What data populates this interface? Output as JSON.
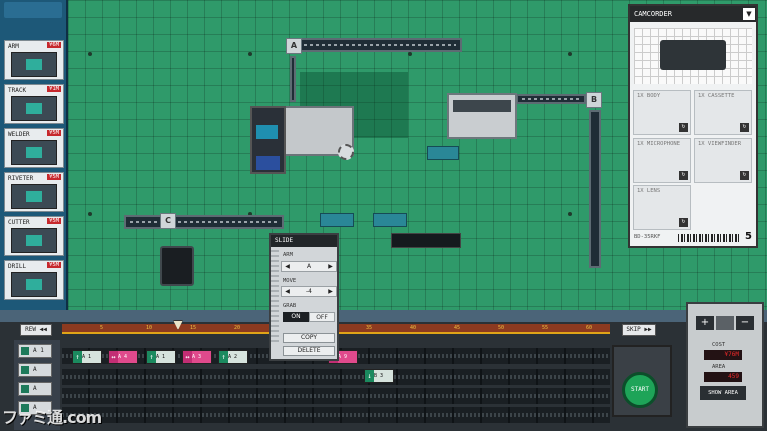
{
  "sidebar": {
    "parts": [
      {
        "name": "ARM",
        "cost": "¥6M"
      },
      {
        "name": "TRACK",
        "cost": "¥1M"
      },
      {
        "name": "WELDER",
        "cost": "¥5M"
      },
      {
        "name": "RIVETER",
        "cost": "¥5M"
      },
      {
        "name": "CUTTER",
        "cost": "¥5M"
      },
      {
        "name": "DRILL",
        "cost": "¥5M"
      }
    ]
  },
  "floor": {
    "nodes": {
      "a": "A",
      "b": "B",
      "c": "C"
    },
    "camcorder_label": "CAMCORDER"
  },
  "blueprint": {
    "title": "CAMCORDER",
    "dropdown": "▼",
    "cells": [
      {
        "label": "1X BODY"
      },
      {
        "label": "1X CASSETTE"
      },
      {
        "label": "1X MICROPHONE"
      },
      {
        "label": "1X VIEWFINDER"
      },
      {
        "label": "1X LENS"
      }
    ],
    "code": "BD-35RKF",
    "count": "5"
  },
  "popup": {
    "title": "SLIDE",
    "arm_label": "ARM",
    "arm_value": "A",
    "move_label": "MOVE",
    "move_value": "-4",
    "grab_label": "GRAB",
    "grab_on": "ON",
    "grab_off": "OFF",
    "copy": "COPY",
    "delete": "DELETE"
  },
  "timeline": {
    "rew": "REW ◀◀",
    "skip": "SKIP ▶▶",
    "track_heads": [
      "A 1",
      "A",
      "A",
      "A"
    ],
    "ticks": [
      "5",
      "10",
      "15",
      "20",
      "25",
      "30",
      "35",
      "40",
      "45",
      "50",
      "55",
      "60"
    ],
    "instructions": [
      {
        "label": "A 1",
        "kind": "green",
        "lead": "↑"
      },
      {
        "label": "A 4",
        "kind": "pink",
        "lead": "↔"
      },
      {
        "label": "A 1",
        "kind": "green",
        "lead": "↑"
      },
      {
        "label": "A 3",
        "kind": "pink",
        "lead": "↔"
      },
      {
        "label": "A 2",
        "kind": "green",
        "lead": "↑"
      },
      {
        "label": "A 9",
        "kind": "pink",
        "lead": "↔"
      },
      {
        "label": "B 3",
        "kind": "green",
        "lead": "↓"
      }
    ]
  },
  "stats": {
    "zoom_in": "+",
    "zoom_out": "−",
    "cost_label": "COST",
    "cost_value": "¥76M",
    "area_label": "AREA",
    "area_value": "459",
    "show_area": "SHOW AREA"
  },
  "start": "START",
  "watermark": "ファミ通.com"
}
